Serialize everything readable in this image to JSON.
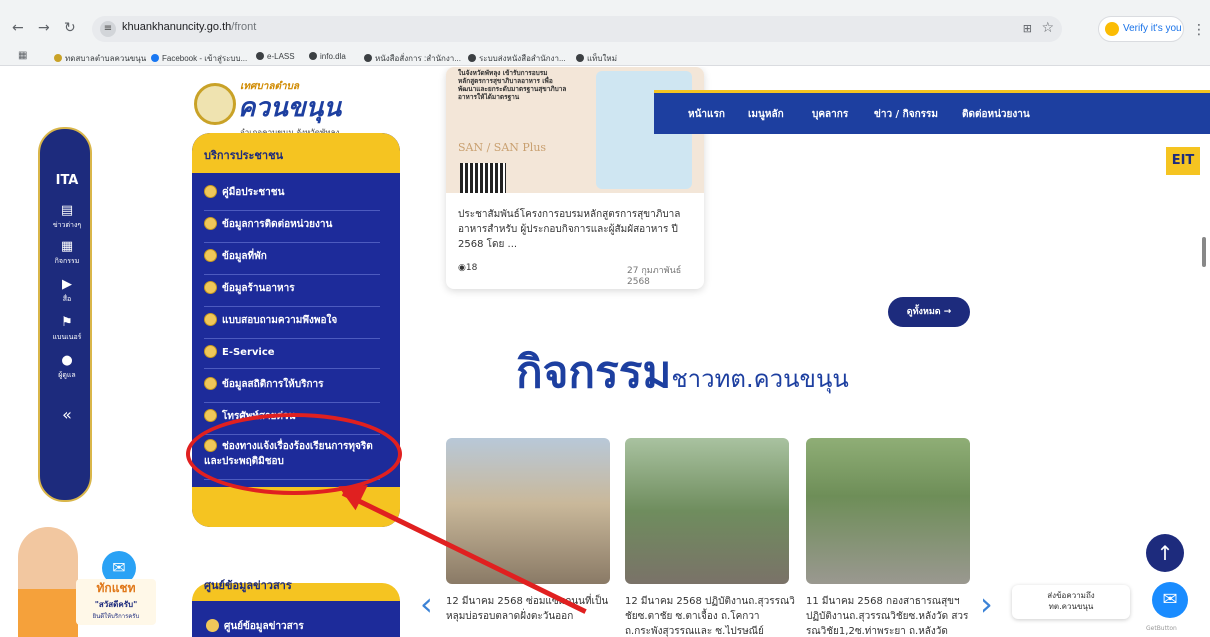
{
  "browser": {
    "url_host": "khuankhanuncity.go.th",
    "url_path": "/front",
    "verify_label": "Verify it's you",
    "bookmarks": [
      "ทดสบาลตำบลควนขนุน",
      "Facebook - เข้าสู่ระบบ...",
      "e-LASS",
      "info.dla",
      "หนังสือสั่งการ :สำนักงา...",
      "ระบบส่งหนังสือสำนักงา...",
      "แท็บใหม่"
    ]
  },
  "logo": {
    "small": "เทศบาลตำบล",
    "big": "ควนขนุน",
    "sub": "อำเภอควนขนุน จังหวัดพัทลุง"
  },
  "rail": {
    "brand": "ITA",
    "items": [
      "ข่าวต่างๆ",
      "กิจกรรม",
      "สื่อ",
      "แบนเนอร์",
      "ผู้ดูแล"
    ],
    "collapse": "«"
  },
  "service": {
    "title": "บริการประชาชน",
    "items": [
      "คู่มือประชาชน",
      "ข้อมูลการติดต่อหน่วยงาน",
      "ข้อมูลที่พัก",
      "ข้อมูลร้านอาหาร",
      "แบบสอบถามความพึงพอใจ",
      "E-Service",
      "ข้อมูลสถิติการให้บริการ",
      "โทรศัพท์สายด่วน",
      "ช่องทางแจ้งเรื่องร้องเรียนการทุจริตและประพฤติมิชอบ"
    ]
  },
  "info": {
    "title": "ศูนย์ข้อมูลข่าวสาร",
    "item": "ศูนย์ข้อมูลข่าวสาร"
  },
  "news": {
    "img_text": "ในจังหวัดพัทลุง เข้ารับการอบรมหลักสูตรการสุขาภิบาลอาหาร เพื่อพัฒนาและยกระดับมาตรฐานสุขาภิบาลอาหารให้ได้มาตรฐาน",
    "san": "SAN / SAN Plus",
    "text": "ประชาสัมพันธ์โครงการอบรมหลักสูตรการสุขาภิบาลอาหารสำหรับ ผู้ประกอบกิจการและผู้สัมผัสอาหาร ปี 2568 โดย ...",
    "views": "18",
    "date": "27 กุมภาพันธ์ 2568"
  },
  "nav": [
    "หน้าแรก",
    "เมนูหลัก",
    "บุคลากร",
    "ข่าว / กิจกรรม",
    "ติดต่อหน่วยงาน"
  ],
  "eit": "EIT",
  "viewall": "ดูทั้งหมด →",
  "activities": {
    "title": "กิจกรรม",
    "subtitle": "ชาวทต.ควนขนุน",
    "cards": [
      "12 มีนาคม 2568 ซ่อมแซมถนนที่เป็นหลุมบ่อรอบตลาดฝั่งตะวันออก",
      "12 มีนาคม 2568 ปฏิบัติงานถ.สุวรรณวิชัยซ.ตาชัย ซ.ตาเจื้อง ถ.โคกวา ถ.กระพังสุวรรณและ ซ.ไปรษณีย์",
      "11 มีนาคม 2568 กองสาธารณสุขฯ ปฏิบัติงานถ.สุวรรณวิชัยซ.หลังวัด สวรรณวิชัย1,2ซ.ท่าพระยา ถ.หลังวัด"
    ]
  },
  "chat": {
    "l1": "ส่งข้อความถึง",
    "l2": "ทต.ควนขนุน",
    "getbutton": "GetButton"
  },
  "mascot": {
    "l1": "ทักแชท",
    "l2": "\"สวัสดีครับ\"",
    "l3": "ยินดีให้บริการครับ"
  }
}
